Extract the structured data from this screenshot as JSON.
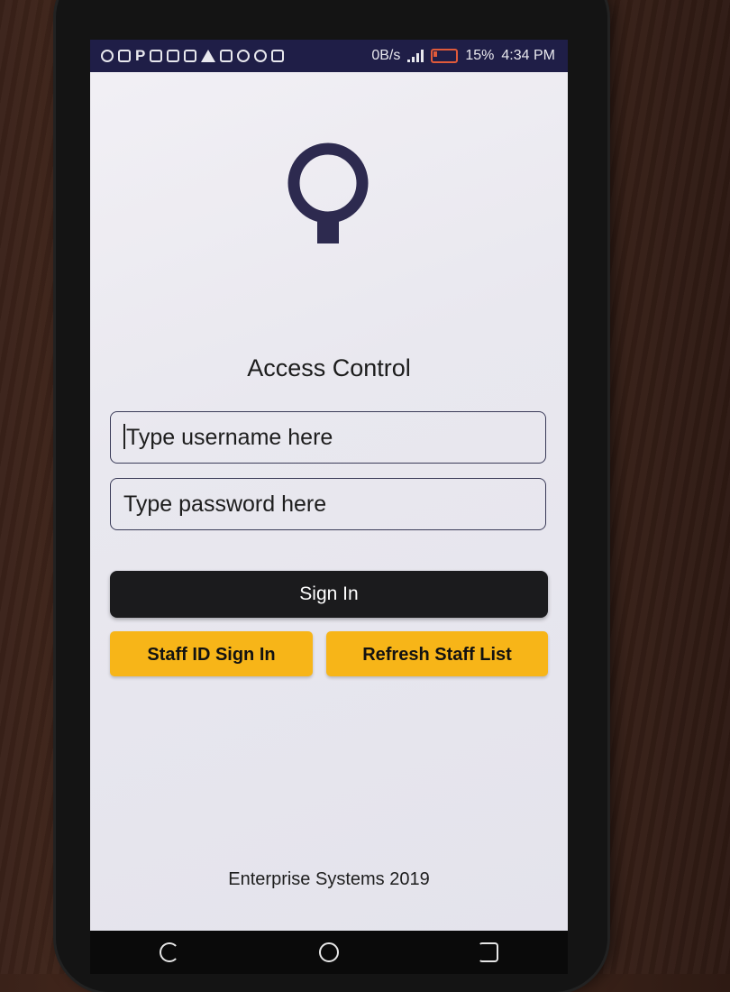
{
  "status_bar": {
    "data_rate": "0B/s",
    "battery_percent": "15%",
    "time": "4:34 PM",
    "icons": [
      "chat-icon",
      "sim-icon",
      "parking-icon",
      "shirt-icon",
      "image-icon",
      "mail-icon",
      "warning-icon",
      "phone-icon",
      "cloud-icon",
      "shield-icon",
      "pulse-icon"
    ]
  },
  "app": {
    "logo_icon": "lock-ring-logo",
    "title": "Access Control",
    "username_placeholder": "Type username here",
    "password_placeholder": "Type password here",
    "sign_in_label": "Sign In",
    "staff_id_sign_in_label": "Staff ID Sign In",
    "refresh_staff_list_label": "Refresh Staff List",
    "footer": "Enterprise Systems 2019"
  },
  "colors": {
    "status_bar": "#1f1e47",
    "logo": "#2d2a4f",
    "sign_in_button": "#1b1b1d",
    "accent_yellow": "#f7b518"
  },
  "nav_bar": {
    "icons": [
      "back-icon",
      "home-icon",
      "recents-icon"
    ]
  }
}
